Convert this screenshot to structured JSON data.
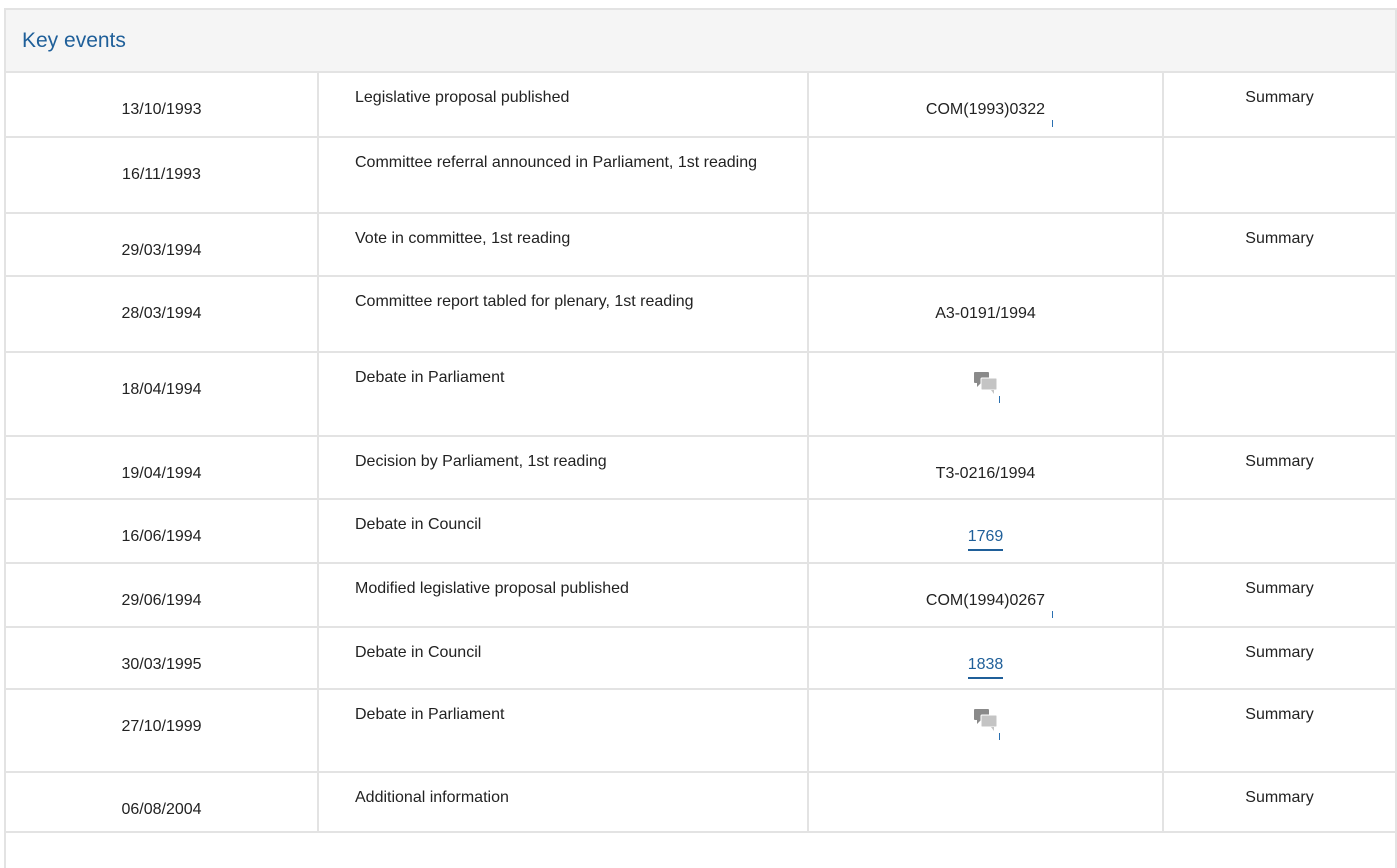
{
  "panel": {
    "title": "Key events"
  },
  "events": [
    {
      "date": "13/10/1993",
      "event": "Legislative proposal published",
      "ref": "COM(1993)0322",
      "ref_type": "doc",
      "summary": "Summary"
    },
    {
      "date": "16/11/1993",
      "event": "Committee referral announced in Parliament, 1st reading",
      "ref": "",
      "ref_type": "none",
      "summary": ""
    },
    {
      "date": "29/03/1994",
      "event": "Vote in committee, 1st reading",
      "ref": "",
      "ref_type": "none",
      "summary": "Summary"
    },
    {
      "date": "28/03/1994",
      "event": "Committee report tabled for plenary, 1st reading",
      "ref": "A3-0191/1994",
      "ref_type": "text",
      "summary": ""
    },
    {
      "date": "18/04/1994",
      "event": "Debate in Parliament",
      "ref": "",
      "ref_type": "debate",
      "summary": ""
    },
    {
      "date": "19/04/1994",
      "event": "Decision by Parliament, 1st reading",
      "ref": "T3-0216/1994",
      "ref_type": "text",
      "summary": "Summary"
    },
    {
      "date": "16/06/1994",
      "event": "Debate in Council",
      "ref": "1769",
      "ref_type": "link",
      "summary": ""
    },
    {
      "date": "29/06/1994",
      "event": "Modified legislative proposal published",
      "ref": "COM(1994)0267",
      "ref_type": "doc",
      "summary": "Summary"
    },
    {
      "date": "30/03/1995",
      "event": "Debate in Council",
      "ref": "1838",
      "ref_type": "link",
      "summary": "Summary"
    },
    {
      "date": "27/10/1999",
      "event": "Debate in Parliament",
      "ref": "",
      "ref_type": "debate",
      "summary": "Summary"
    },
    {
      "date": "06/08/2004",
      "event": "Additional information",
      "ref": "",
      "ref_type": "none",
      "summary": "Summary"
    }
  ],
  "icons": {
    "debate": "debate-speech-bubbles-icon"
  },
  "colors": {
    "title": "#1f5f99",
    "link": "#1f5f99",
    "border": "#e3e3e3",
    "header_bg": "#f5f5f5"
  }
}
